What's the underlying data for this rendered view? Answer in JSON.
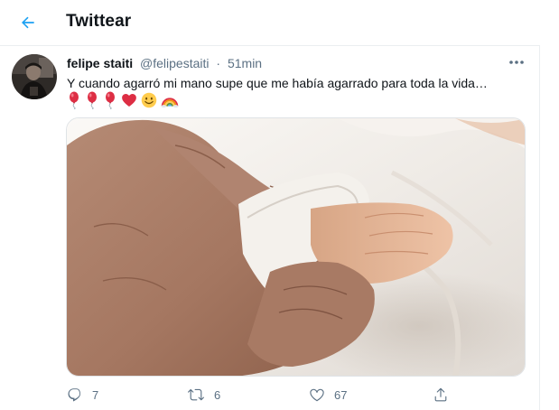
{
  "header": {
    "title": "Twittear"
  },
  "tweet": {
    "author_name": "felipe staiti",
    "author_handle": "@felipestaiti",
    "separator": "·",
    "time": "51min",
    "text": "Y cuando agarró mi mano supe que me había agarrado para toda la vida…",
    "emojis": [
      "balloon-icon",
      "balloon-icon",
      "balloon-icon",
      "red-heart-icon",
      "smiley-icon",
      "rainbow-icon"
    ],
    "media_description_icons": [
      "hand-photo"
    ],
    "actions": {
      "reply_count": "7",
      "retweet_count": "6",
      "like_count": "67"
    }
  },
  "colors": {
    "accent": "#1da1f2",
    "secondary_text": "#5b7083",
    "divider": "#ebeef0",
    "heart": "#e0245e"
  }
}
